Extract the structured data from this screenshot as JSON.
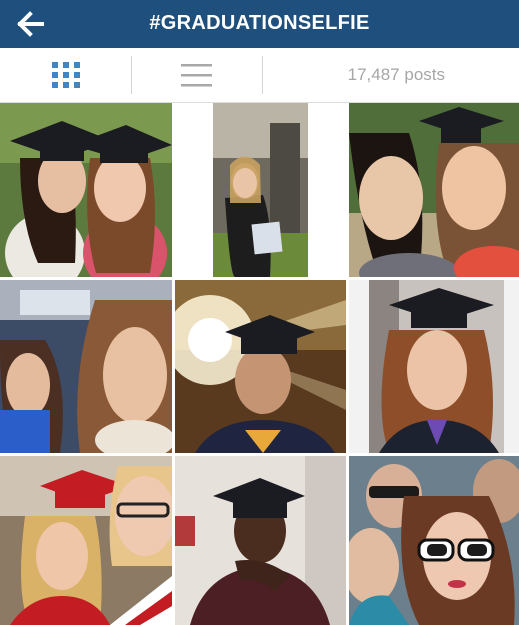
{
  "header": {
    "title": "#GRADUATIONSELFIE",
    "background_color": "#1f4f7c",
    "back_icon": "arrow-left-icon"
  },
  "toolbar": {
    "grid_view_icon": "grid-icon",
    "list_view_icon": "list-icon",
    "active_view": "grid",
    "accent_color": "#3f86c4",
    "post_count": "17,487 posts"
  },
  "posts": [
    {
      "id": 1,
      "subject": "two women in graduation caps"
    },
    {
      "id": 2,
      "subject": "graduate holding diploma outside building"
    },
    {
      "id": 3,
      "subject": "two women smiling selfie"
    },
    {
      "id": 4,
      "subject": "two women in car"
    },
    {
      "id": 5,
      "subject": "young man in cap with sun flare"
    },
    {
      "id": 6,
      "subject": "woman in cap and gown"
    },
    {
      "id": 7,
      "subject": "two women, one in red cap"
    },
    {
      "id": 8,
      "subject": "young man in cap, hand on chin"
    },
    {
      "id": 9,
      "subject": "group selfie with sunglasses"
    }
  ]
}
